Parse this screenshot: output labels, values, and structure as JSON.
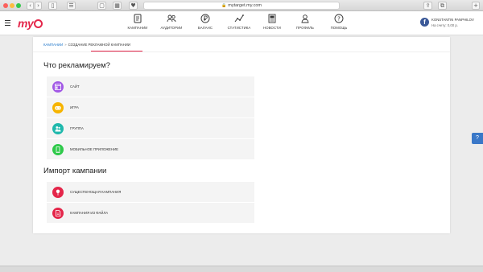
{
  "browser": {
    "url": "mytarget.my.com"
  },
  "header": {
    "logo": "my",
    "nav": [
      {
        "label": "КАМПАНИИ",
        "icon": "campaigns-icon"
      },
      {
        "label": "АУДИТОРИИ",
        "icon": "audiences-icon"
      },
      {
        "label": "БАЛАНС",
        "icon": "balance-icon"
      },
      {
        "label": "СТАТИСТИКА",
        "icon": "statistics-icon"
      },
      {
        "label": "НОВОСТИ",
        "icon": "news-icon"
      },
      {
        "label": "ПРОФИЛЬ",
        "icon": "profile-icon"
      },
      {
        "label": "ПОМОЩЬ",
        "icon": "help-icon"
      }
    ],
    "user": {
      "name": "KONSTANTIN PANPHILOV",
      "balance": "На счету: 0,00 р."
    }
  },
  "breadcrumb": {
    "parent": "КАМПАНИИ",
    "separator": "»",
    "current": "СОЗДАНИЕ РЕКЛАМНОЙ КАМПАНИИ"
  },
  "advertise": {
    "title": "Что рекламируем?",
    "options": [
      {
        "label": "САЙТ",
        "icon": "site-icon",
        "color": "#a259e6"
      },
      {
        "label": "ИГРА",
        "icon": "gamepad-icon",
        "color": "#f6b400"
      },
      {
        "label": "ГРУППА",
        "icon": "group-icon",
        "color": "#1fb8ac"
      },
      {
        "label": "МОБИЛЬНОЕ ПРИЛОЖЕНИЕ",
        "icon": "mobile-app-icon",
        "color": "#2ec94a"
      }
    ]
  },
  "import": {
    "title": "Импорт кампании",
    "options": [
      {
        "label": "СУЩЕСТВУЮЩАЯ КАМПАНИЯ",
        "icon": "existing-campaign-icon",
        "color": "#e4264a"
      },
      {
        "label": "КАМПАНИЯ ИЗ ФАЙЛА",
        "icon": "file-icon",
        "color": "#e4264a"
      }
    ]
  },
  "help_tab": "?",
  "colors": {
    "brand": "#e4264a",
    "link": "#1a73c8"
  }
}
